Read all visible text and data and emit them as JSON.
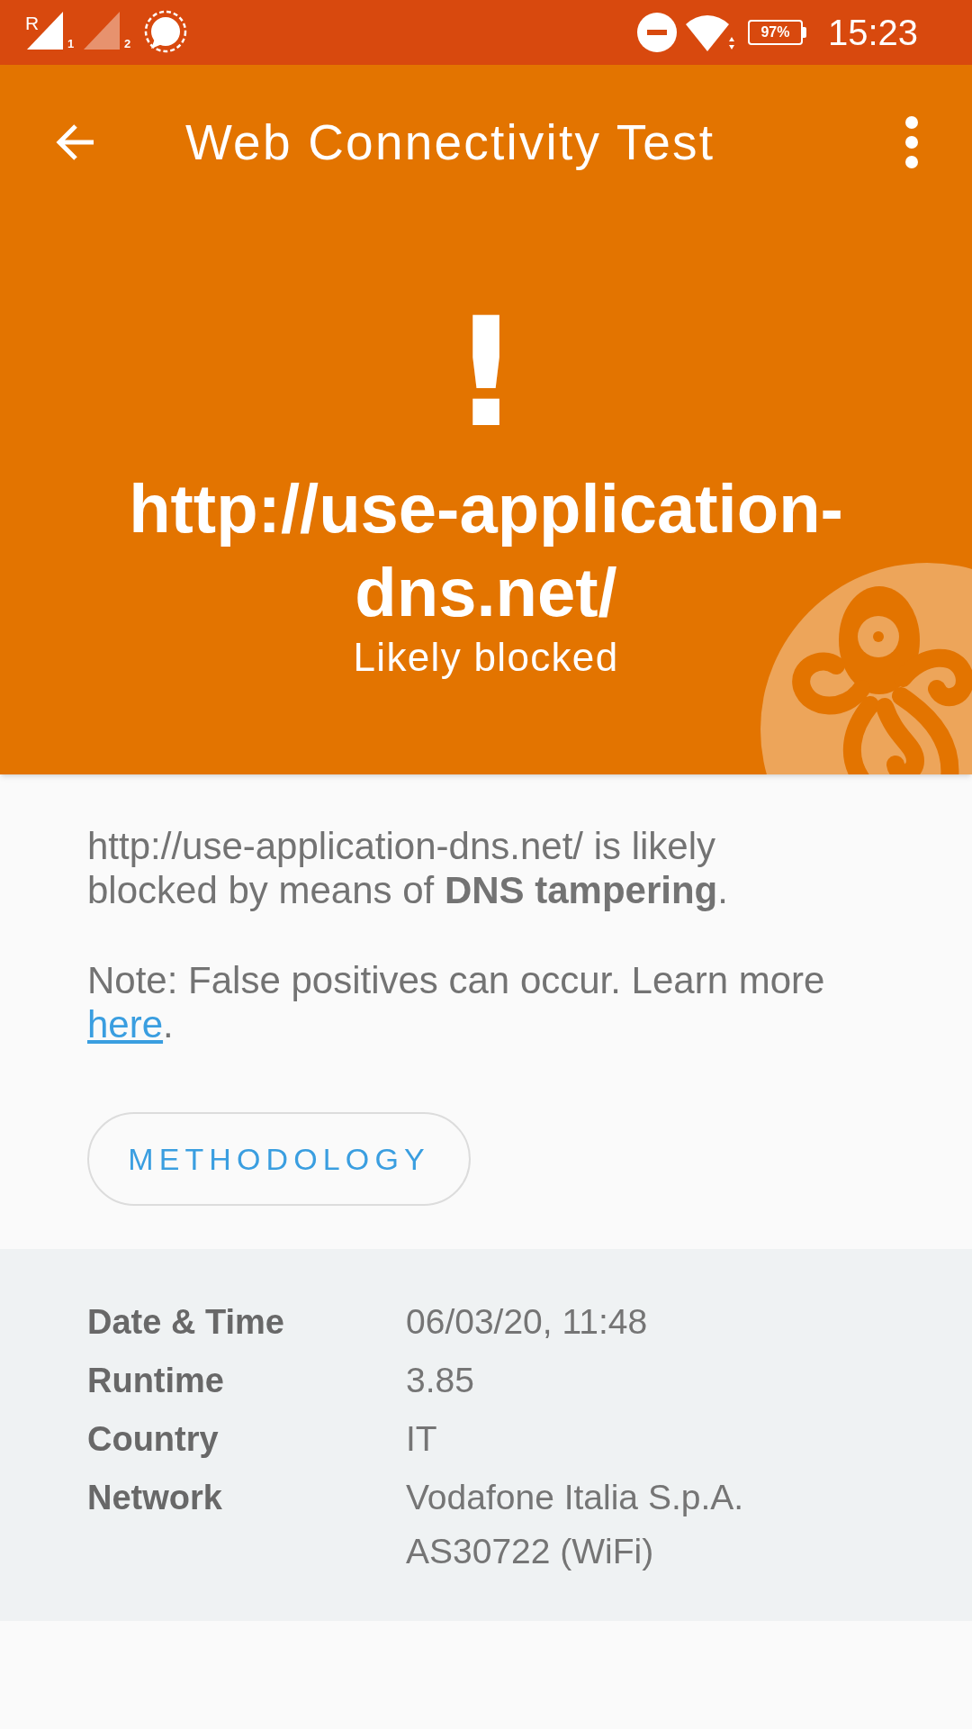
{
  "status_bar": {
    "sims": [
      {
        "roaming": "R",
        "slot": "1",
        "active": true
      },
      {
        "slot": "2",
        "active": false
      }
    ],
    "battery": "97%",
    "time": "15:23"
  },
  "toolbar": {
    "title": "Web Connectivity Test"
  },
  "result": {
    "symbol": "!",
    "url": "http://use-application-dns.net/",
    "verdict": "Likely blocked"
  },
  "explanation": "http://use-application-dns.net/ is likely blocked by means of **DNS tampering**.",
  "note": {
    "text": "Note: False positives can occur. Learn more",
    "link": "here",
    "after": "."
  },
  "methodology_button": "METHODOLOGY",
  "details": [
    {
      "label": "Date & Time",
      "value": "06/03/20, 11:48"
    },
    {
      "label": "Runtime",
      "value": "3.85"
    },
    {
      "label": "Country",
      "value": "IT"
    },
    {
      "label": "Network",
      "value": "Vodafone Italia S.p.A. AS30722 (WiFi)"
    }
  ]
}
